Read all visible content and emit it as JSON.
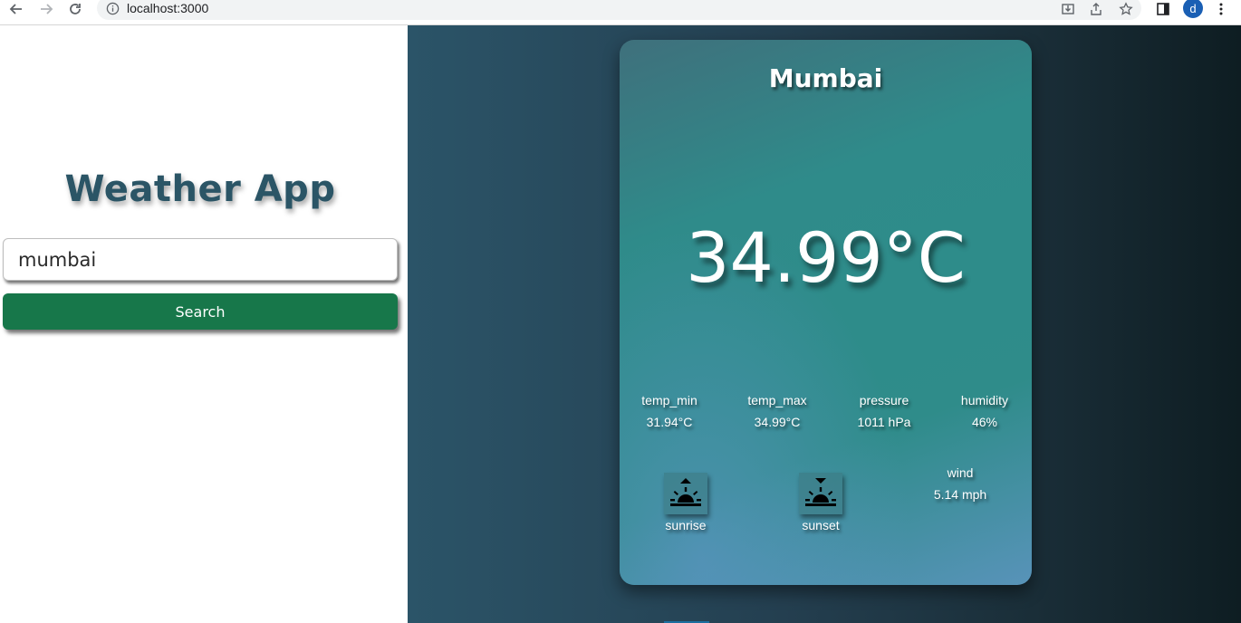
{
  "browser": {
    "url": "localhost:3000",
    "profile_initial": "d"
  },
  "app": {
    "title": "Weather App",
    "search_value": "mumbai",
    "search_button": "Search"
  },
  "weather": {
    "city": "Mumbai",
    "temperature": "34.99°C",
    "stats": [
      {
        "label": "temp_min",
        "value": "31.94°C"
      },
      {
        "label": "temp_max",
        "value": "34.99°C"
      },
      {
        "label": "pressure",
        "value": "1011 hPa"
      },
      {
        "label": "humidity",
        "value": "46%"
      }
    ],
    "wind": {
      "label": "wind",
      "value": "5.14 mph"
    },
    "sunrise_label": "sunrise",
    "sunset_label": "sunset"
  },
  "colors": {
    "title": "#2b5566",
    "button": "#17774a",
    "card": "#2e8c8a"
  }
}
